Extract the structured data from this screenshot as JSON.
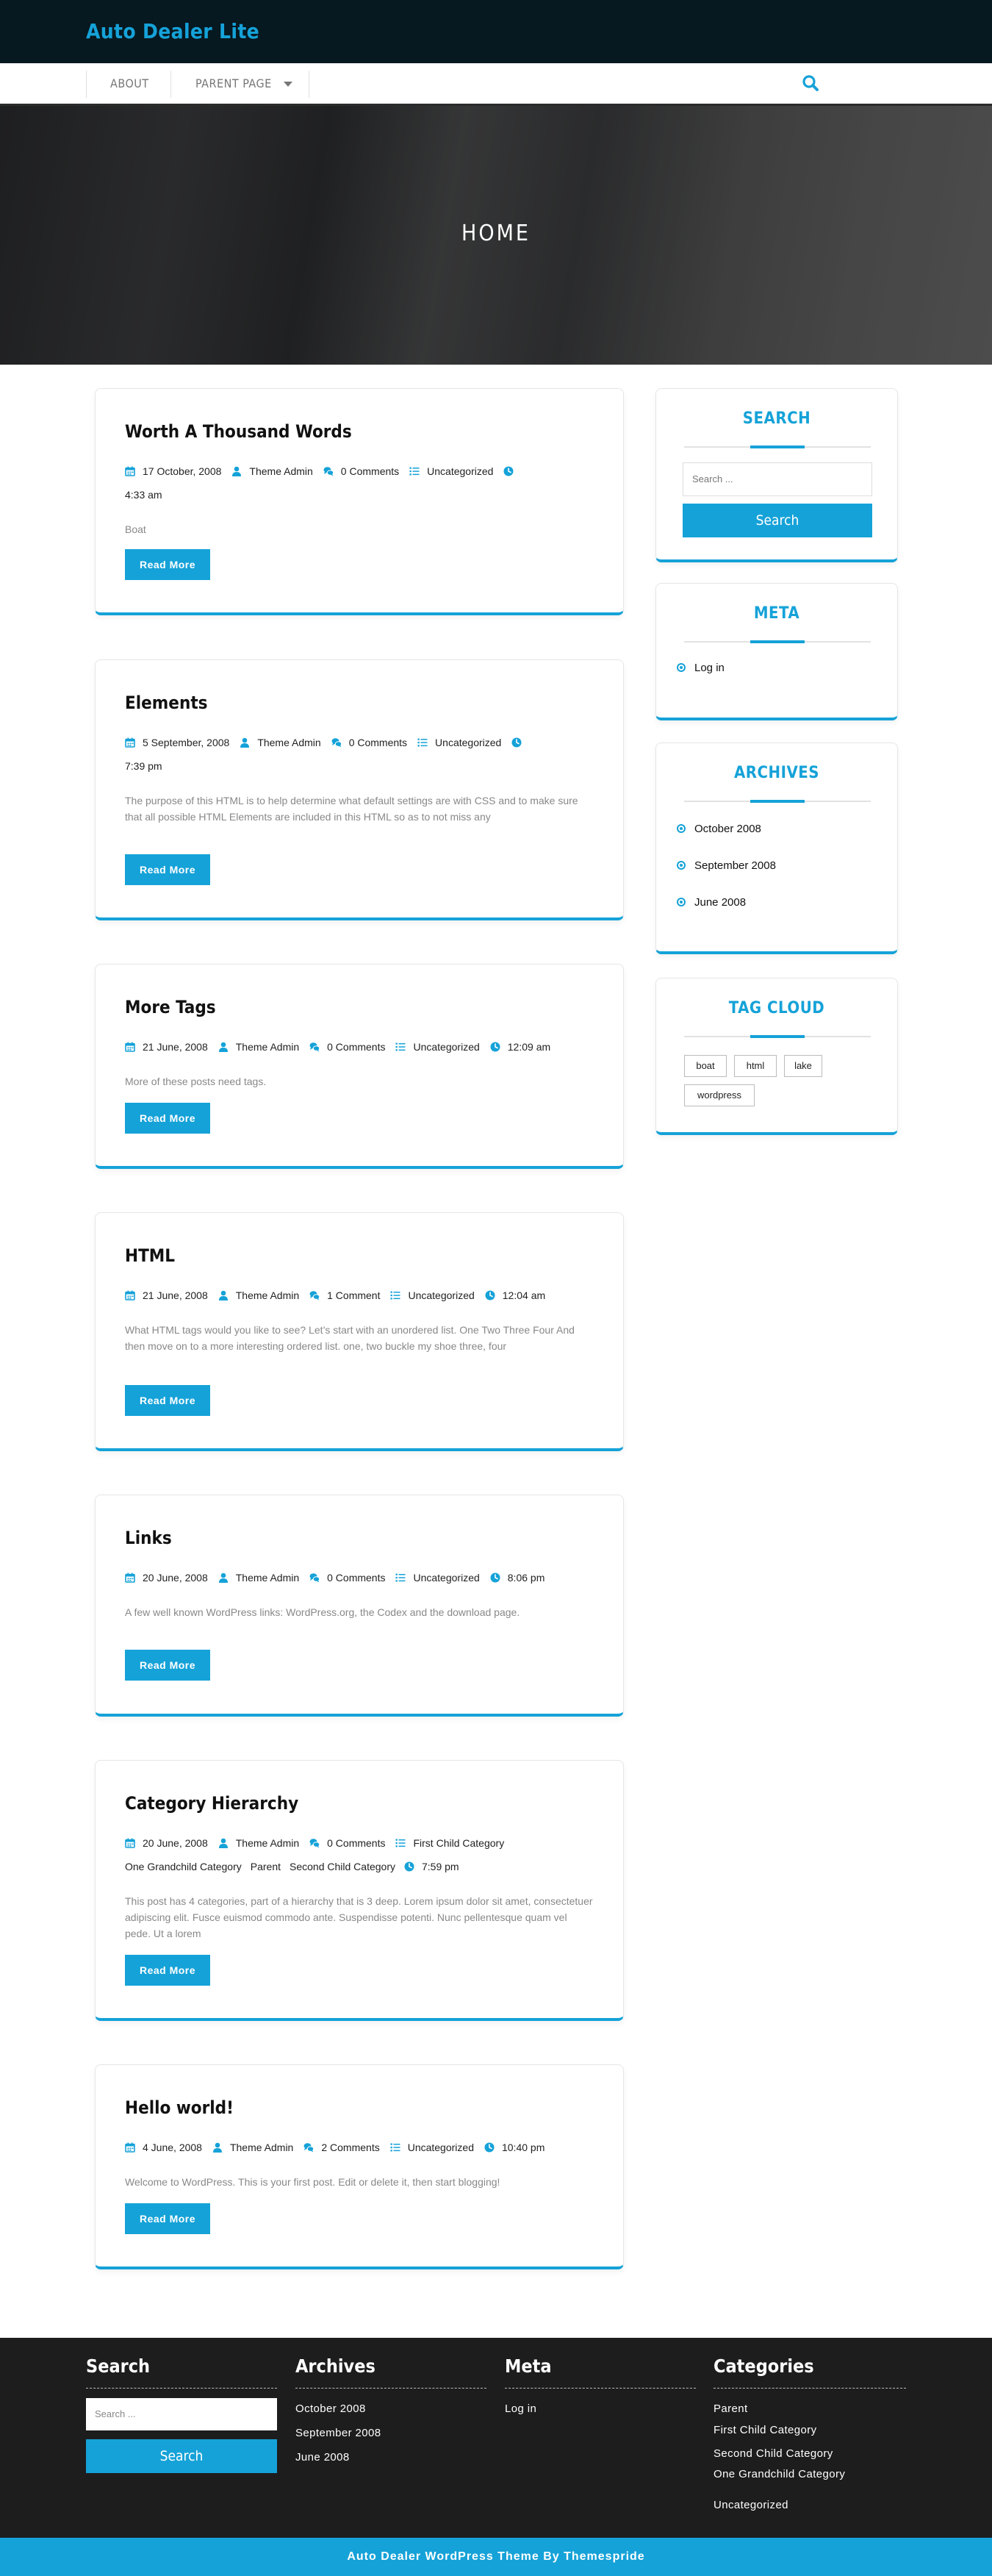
{
  "header": {
    "site_title": "Auto Dealer Lite"
  },
  "nav": {
    "items": [
      {
        "label": "ABOUT"
      },
      {
        "label": "PARENT PAGE"
      }
    ],
    "search_icon": "search-icon"
  },
  "hero": {
    "title": "HOME"
  },
  "read_more_label": "Read More",
  "posts": [
    {
      "title": "Worth A Thousand Words",
      "date": "17 October, 2008",
      "author": "Theme Admin",
      "comments": "0 Comments",
      "categories": [
        "Uncategorized"
      ],
      "time": "4:33 am",
      "excerpt": "Boat"
    },
    {
      "title": "Elements",
      "date": "5 September, 2008",
      "author": "Theme Admin",
      "comments": "0 Comments",
      "categories": [
        "Uncategorized"
      ],
      "time": "7:39 pm",
      "excerpt": "The purpose of this HTML is to help determine what default settings are with CSS and to make sure that all possible HTML Elements are included in this HTML so as to not miss any"
    },
    {
      "title": "More Tags",
      "date": "21 June, 2008",
      "author": "Theme Admin",
      "comments": "0 Comments",
      "categories": [
        "Uncategorized"
      ],
      "time": "12:09 am",
      "excerpt": "More of these posts need tags."
    },
    {
      "title": "HTML",
      "date": "21 June, 2008",
      "author": "Theme Admin",
      "comments": "1 Comment",
      "categories": [
        "Uncategorized"
      ],
      "time": "12:04 am",
      "excerpt": "What HTML tags would you like to see? Let’s start with an unordered list. One Two Three Four And then move on to a more interesting ordered list. one, two buckle my shoe three, four"
    },
    {
      "title": "Links",
      "date": "20 June, 2008",
      "author": "Theme Admin",
      "comments": "0 Comments",
      "categories": [
        "Uncategorized"
      ],
      "time": "8:06 pm",
      "excerpt": "A few well known WordPress links: WordPress.org, the Codex and the download page."
    },
    {
      "title": "Category Hierarchy",
      "date": "20 June, 2008",
      "author": "Theme Admin",
      "comments": "0 Comments",
      "categories": [
        "First Child Category",
        "One Grandchild Category",
        "Parent",
        "Second Child Category"
      ],
      "time": "7:59 pm",
      "excerpt": "This post has 4 categories, part of a hierarchy that is 3 deep. Lorem ipsum dolor sit amet, consectetuer adipiscing elit. Fusce euismod commodo ante. Suspendisse potenti. Nunc pellentesque quam vel pede. Ut a lorem"
    },
    {
      "title": "Hello world!",
      "date": "4 June, 2008",
      "author": "Theme Admin",
      "comments": "2 Comments",
      "categories": [
        "Uncategorized"
      ],
      "time": "10:40 pm",
      "excerpt": "Welcome to WordPress. This is your first post. Edit or delete it, then start blogging!"
    }
  ],
  "sidebar": {
    "search": {
      "title": "SEARCH",
      "placeholder": "Search ...",
      "button": "Search"
    },
    "meta": {
      "title": "META",
      "items": [
        "Log in"
      ]
    },
    "archives": {
      "title": "ARCHIVES",
      "items": [
        "October 2008",
        "September 2008",
        "June 2008"
      ]
    },
    "tag_cloud": {
      "title": "TAG CLOUD",
      "tags": [
        "boat",
        "html",
        "lake",
        "wordpress"
      ]
    }
  },
  "footer": {
    "search": {
      "title": "Search",
      "placeholder": "Search ...",
      "button": "Search"
    },
    "archives": {
      "title": "Archives",
      "items": [
        "October 2008",
        "September 2008",
        "June 2008"
      ]
    },
    "meta": {
      "title": "Meta",
      "items": [
        "Log in"
      ]
    },
    "categories": {
      "title": "Categories",
      "items": [
        "Parent",
        "First Child Category",
        "Second Child Category",
        "One Grandchild Category",
        "Uncategorized"
      ]
    },
    "credit": "Auto Dealer WordPress Theme By Themespride"
  },
  "colors": {
    "accent": "#15a2d8",
    "topbar": "#061820",
    "footer": "#1d1d1e"
  }
}
